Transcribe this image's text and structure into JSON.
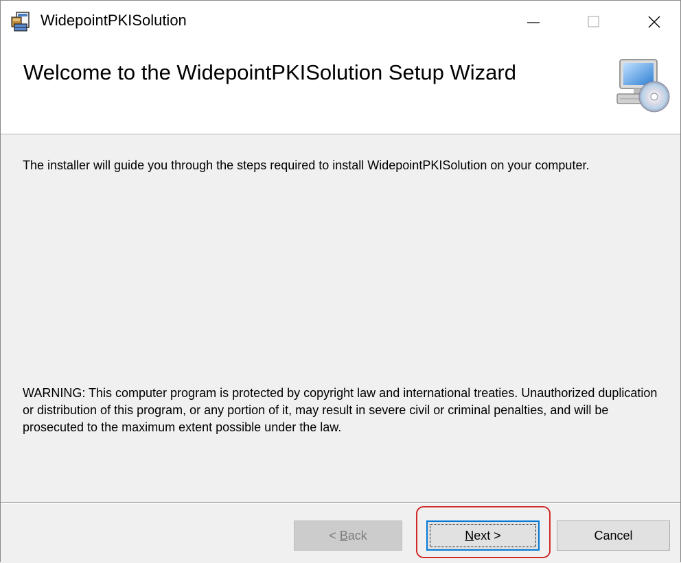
{
  "window": {
    "title": "WidepointPKISolution",
    "app_icon": "installer-package-icon",
    "controls": {
      "minimize_icon": "minimize-icon",
      "maximize_icon": "maximize-icon",
      "close_icon": "close-icon"
    }
  },
  "banner": {
    "title": "Welcome to the WidepointPKISolution Setup Wizard",
    "icon": "computer-cd-icon"
  },
  "content": {
    "intro": "The installer will guide you through the steps required to install WidepointPKISolution on your computer.",
    "warning": "WARNING: This computer program is protected by copyright law and international treaties. Unauthorized duplication or distribution of this program, or any portion of it, may result in severe civil or criminal penalties, and will be prosecuted to the maximum extent possible under the law."
  },
  "buttons": {
    "back": {
      "label_prefix": "< ",
      "label_mnemonic": "B",
      "label_rest": "ack",
      "enabled": false
    },
    "next": {
      "label_mnemonic": "N",
      "label_rest": "ext >",
      "focused": true
    },
    "cancel": {
      "label": "Cancel"
    }
  },
  "colors": {
    "highlight": "#d22a2a",
    "focus_border": "#0078d7",
    "dialog_background": "#f0f0f0"
  }
}
